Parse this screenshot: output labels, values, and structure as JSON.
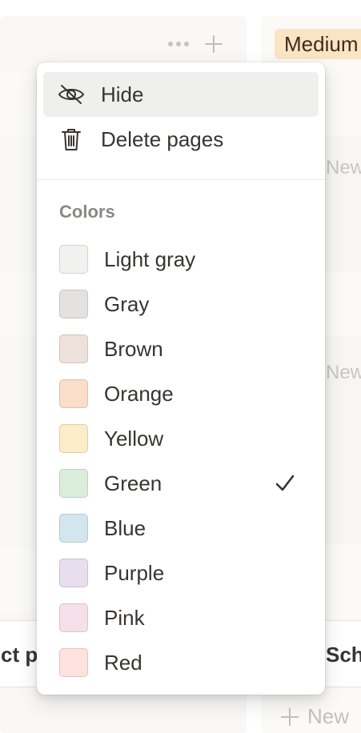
{
  "board": {
    "medium_tag": "Medium",
    "new_hint_1": "New",
    "new_hint_2": "New",
    "card_left_title": "ct pr",
    "card_right_title": "Sch",
    "new_button_label": "New"
  },
  "menu": {
    "hide_label": "Hide",
    "delete_label": "Delete pages",
    "colors_heading": "Colors",
    "selected_color": "Green",
    "colors": [
      {
        "label": "Light gray",
        "swatch": "#f1f1ef"
      },
      {
        "label": "Gray",
        "swatch": "#e3e2e0"
      },
      {
        "label": "Brown",
        "swatch": "#eee0da"
      },
      {
        "label": "Orange",
        "swatch": "#fadec9"
      },
      {
        "label": "Yellow",
        "swatch": "#fdecc8"
      },
      {
        "label": "Green",
        "swatch": "#dbeddb"
      },
      {
        "label": "Blue",
        "swatch": "#d3e5ef"
      },
      {
        "label": "Purple",
        "swatch": "#e8deee"
      },
      {
        "label": "Pink",
        "swatch": "#f5e0e9"
      },
      {
        "label": "Red",
        "swatch": "#ffe2dd"
      }
    ]
  }
}
